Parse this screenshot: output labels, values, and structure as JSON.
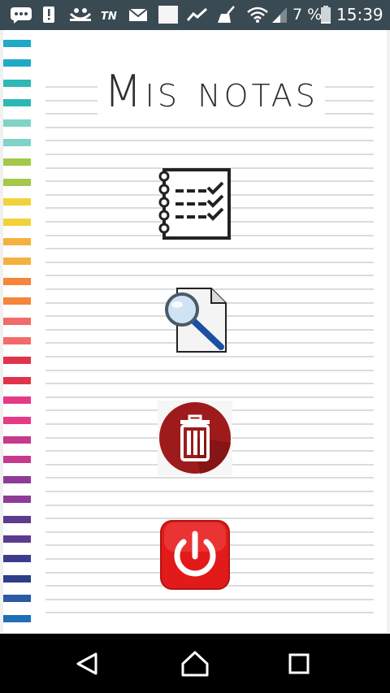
{
  "status_bar": {
    "battery_percent": "7 %",
    "time": "15:39",
    "background": "#3a4a53",
    "icons": [
      "chat-icon",
      "alert-icon",
      "tv-icon",
      "tn-icon",
      "mail-icon",
      "image-icon",
      "trend-icon",
      "broom-icon",
      "wifi-icon",
      "signal-icon",
      "battery-icon"
    ]
  },
  "app": {
    "title": "Mis notas",
    "menu": [
      {
        "name": "notes-list-button",
        "icon": "checklist-icon",
        "label": "Lista de notas"
      },
      {
        "name": "search-note-button",
        "icon": "magnifier-document-icon",
        "label": "Buscar nota"
      },
      {
        "name": "delete-note-button",
        "icon": "trash-icon",
        "label": "Borrar nota"
      },
      {
        "name": "exit-button",
        "icon": "power-icon",
        "label": "Salir"
      }
    ],
    "tab_colors": [
      "#20aac6",
      "#20aac6",
      "#2cb9b6",
      "#2cb9b6",
      "#7fd3c7",
      "#7fd3c7",
      "#a5c84a",
      "#a5c84a",
      "#f2d23a",
      "#f2d23a",
      "#f4b13d",
      "#f4b13d",
      "#f4853a",
      "#f4853a",
      "#f26a6a",
      "#f26a6a",
      "#e1334b",
      "#e1334b",
      "#e63a86",
      "#e63a86",
      "#c63a8e",
      "#c63a8e",
      "#8e3c97",
      "#8e3c97",
      "#5b3c8f",
      "#5b3c8f",
      "#3c3c8f",
      "#2c3f87",
      "#2a5ba3",
      "#1f6eb8"
    ],
    "accent": {
      "delete": "#9e1b1b",
      "exit": "#e21a1a",
      "search": "#1b4fa3"
    }
  },
  "nav_bar": {
    "buttons": [
      "back-icon",
      "home-icon",
      "recents-icon"
    ]
  }
}
